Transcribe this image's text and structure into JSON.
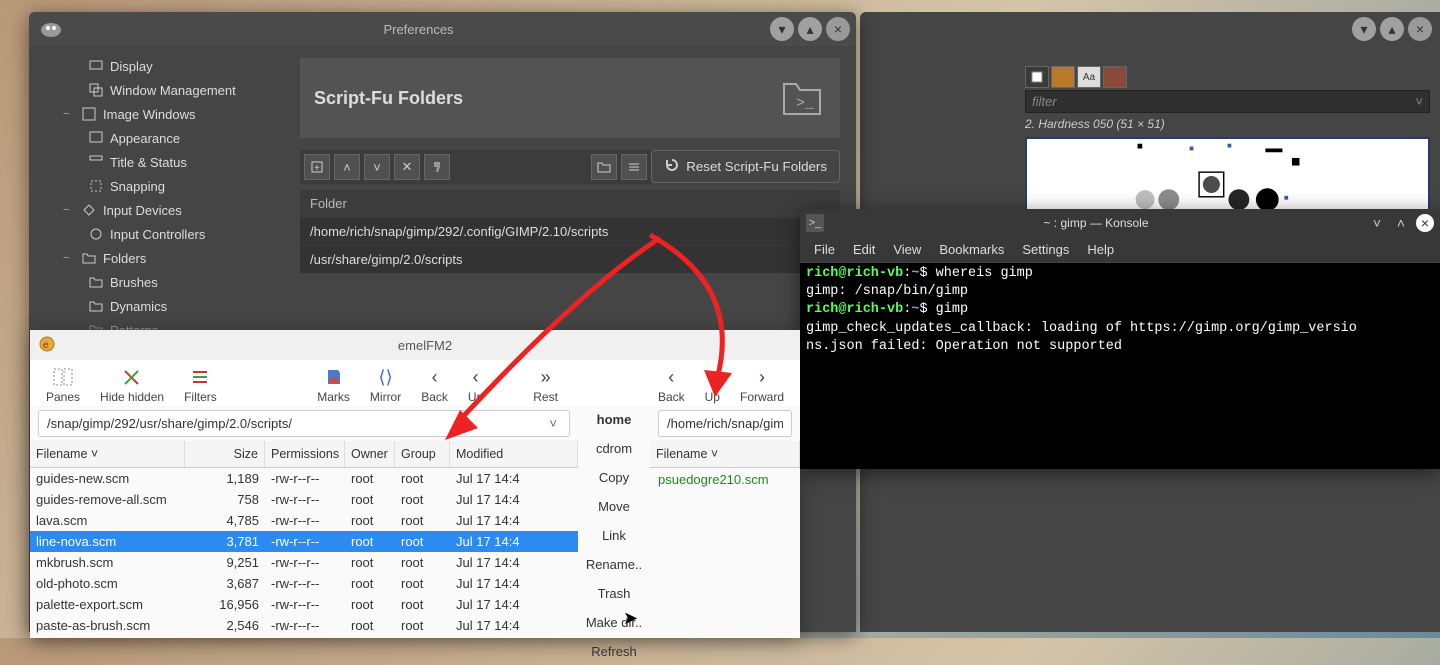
{
  "gimp_prefs": {
    "window_title": "Preferences",
    "tree": {
      "display": "Display",
      "window_mgmt": "Window Management",
      "image_windows": "Image Windows",
      "appearance": "Appearance",
      "title_status": "Title & Status",
      "snapping": "Snapping",
      "input_devices": "Input Devices",
      "input_controllers": "Input Controllers",
      "folders": "Folders",
      "brushes": "Brushes",
      "dynamics": "Dynamics",
      "patterns": "Patterns"
    },
    "content_title": "Script-Fu Folders",
    "reset_btn": "Reset Script-Fu Folders",
    "folder_header": "Folder",
    "folder_rows": [
      "/home/rich/snap/gimp/292/.config/GIMP/2.10/scripts",
      "/usr/share/gimp/2.0/scripts"
    ]
  },
  "gimp_right": {
    "filter_placeholder": "filter",
    "brush_info": "2. Hardness 050 (51 × 51)"
  },
  "konsole": {
    "title": "~ : gimp — Konsole",
    "menu": {
      "file": "File",
      "edit": "Edit",
      "view": "View",
      "bookmarks": "Bookmarks",
      "settings": "Settings",
      "help": "Help"
    },
    "user": "rich@rich-vb",
    "path": "~",
    "cmd1": "whereis gimp",
    "out1": "gimp: /snap/bin/gimp",
    "cmd2": "gimp",
    "out2a": "gimp_check_updates_callback: loading of https://gimp.org/gimp_versio",
    "out2b": "ns.json failed: Operation not supported"
  },
  "fm": {
    "title": "emelFM2",
    "toolbar_left": {
      "panes": "Panes",
      "hide_hidden": "Hide hidden",
      "filters": "Filters"
    },
    "toolbar_right_a": {
      "marks": "Marks",
      "mirror": "Mirror",
      "back": "Back",
      "up": "Up"
    },
    "toolbar_right_b": {
      "rest": "Rest"
    },
    "toolbar_right_c": {
      "back2": "Back",
      "up2": "Up",
      "forward": "Forward"
    },
    "mid": {
      "home": "home",
      "cdrom": "cdrom",
      "copy": "Copy",
      "move": "Move",
      "link": "Link",
      "rename": "Rename..",
      "trash": "Trash",
      "makedir": "Make dir..",
      "refresh": "Refresh"
    },
    "left_path": "/snap/gimp/292/usr/share/gimp/2.0/scripts/",
    "right_path": "/home/rich/snap/gimp",
    "headers": {
      "filename": "Filename",
      "size": "Size",
      "permissions": "Permissions",
      "owner": "Owner",
      "group": "Group",
      "modified": "Modified"
    },
    "rows": [
      {
        "name": "guides-new.scm",
        "size": "1,189",
        "perm": "-rw-r--r--",
        "owner": "root",
        "group": "root",
        "mod": "Jul 17 14:4",
        "sel": false
      },
      {
        "name": "guides-remove-all.scm",
        "size": "758",
        "perm": "-rw-r--r--",
        "owner": "root",
        "group": "root",
        "mod": "Jul 17 14:4",
        "sel": false
      },
      {
        "name": "lava.scm",
        "size": "4,785",
        "perm": "-rw-r--r--",
        "owner": "root",
        "group": "root",
        "mod": "Jul 17 14:4",
        "sel": false
      },
      {
        "name": "line-nova.scm",
        "size": "3,781",
        "perm": "-rw-r--r--",
        "owner": "root",
        "group": "root",
        "mod": "Jul 17 14:4",
        "sel": true
      },
      {
        "name": "mkbrush.scm",
        "size": "9,251",
        "perm": "-rw-r--r--",
        "owner": "root",
        "group": "root",
        "mod": "Jul 17 14:4",
        "sel": false
      },
      {
        "name": "old-photo.scm",
        "size": "3,687",
        "perm": "-rw-r--r--",
        "owner": "root",
        "group": "root",
        "mod": "Jul 17 14:4",
        "sel": false
      },
      {
        "name": "palette-export.scm",
        "size": "16,956",
        "perm": "-rw-r--r--",
        "owner": "root",
        "group": "root",
        "mod": "Jul 17 14:4",
        "sel": false
      },
      {
        "name": "paste-as-brush.scm",
        "size": "2,546",
        "perm": "-rw-r--r--",
        "owner": "root",
        "group": "root",
        "mod": "Jul 17 14:4",
        "sel": false
      }
    ],
    "right_file": "psuedogre210.scm"
  }
}
